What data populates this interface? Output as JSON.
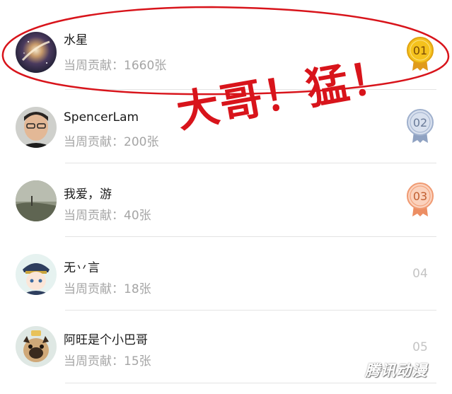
{
  "ranking": {
    "items": [
      {
        "name": "水星",
        "contribution_label": "当周贡献：",
        "contribution_value": "1660张",
        "rank": "01",
        "medal": "gold",
        "avatar_icon": "galaxy-avatar"
      },
      {
        "name": "SpencerLam",
        "contribution_label": "当周贡献：",
        "contribution_value": "200张",
        "rank": "02",
        "medal": "silver",
        "avatar_icon": "man-photo-avatar"
      },
      {
        "name": "我爱，游",
        "contribution_label": "当周贡献：",
        "contribution_value": "40张",
        "rank": "03",
        "medal": "bronze",
        "avatar_icon": "landscape-avatar"
      },
      {
        "name": "无丷言",
        "contribution_label": "当周贡献：",
        "contribution_value": "18张",
        "rank": "04",
        "medal": "none",
        "avatar_icon": "anime-avatar"
      },
      {
        "name": "阿旺是个小巴哥",
        "contribution_label": "当周贡献：",
        "contribution_value": "15张",
        "rank": "05",
        "medal": "none",
        "avatar_icon": "pug-avatar"
      }
    ]
  },
  "annotation": {
    "handwriting": "大哥！猛！",
    "circle_color": "#d8141b"
  },
  "watermark": {
    "text": "腾讯动漫"
  },
  "colors": {
    "gold": "#f0b41c",
    "silver": "#a9b8d2",
    "bronze": "#f3a47e",
    "muted_text": "#a5a5a5"
  }
}
